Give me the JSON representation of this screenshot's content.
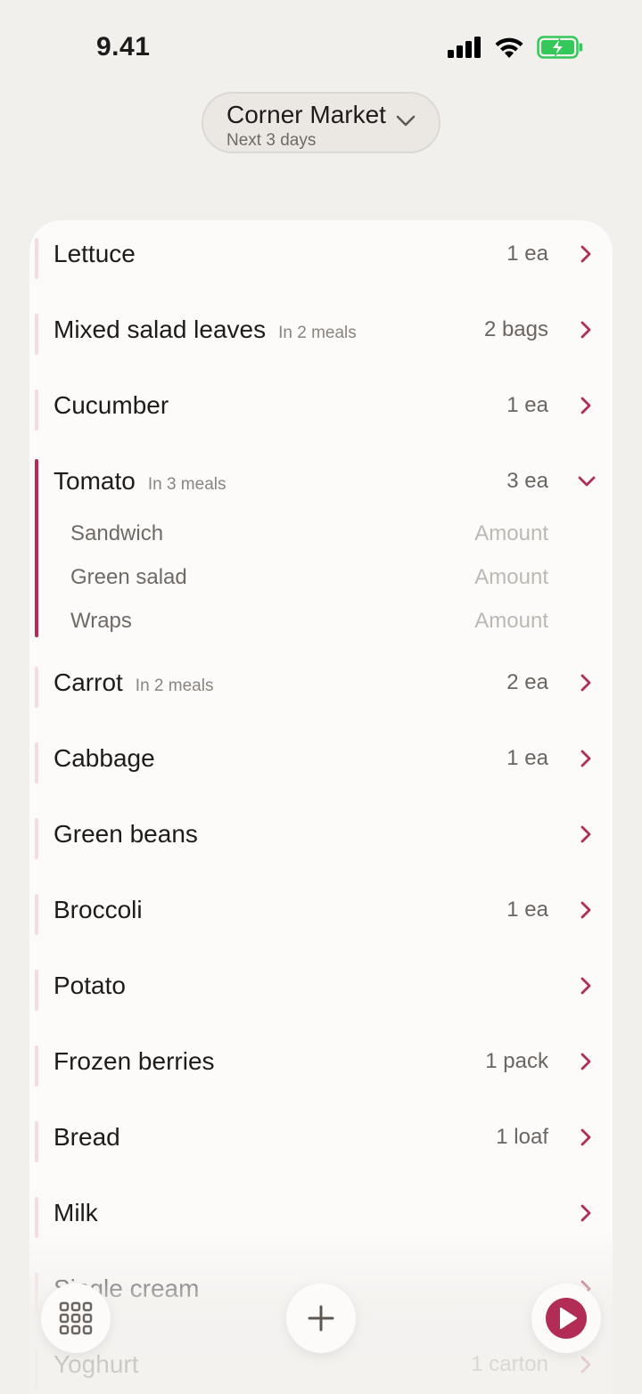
{
  "status_bar": {
    "time": "9.41"
  },
  "store": {
    "name": "Corner Market",
    "range": "Next 3 days"
  },
  "items": [
    {
      "name": "Lettuce",
      "meals": "",
      "qty": "1 ea"
    },
    {
      "name": "Mixed salad leaves",
      "meals": "In 2 meals",
      "qty": "2 bags"
    },
    {
      "name": "Cucumber",
      "meals": "",
      "qty": "1 ea"
    },
    {
      "name": "Tomato",
      "meals": "In 3 meals",
      "qty": "3 ea"
    },
    {
      "name": "Carrot",
      "meals": "In 2 meals",
      "qty": "2 ea"
    },
    {
      "name": "Cabbage",
      "meals": "",
      "qty": "1 ea"
    },
    {
      "name": "Green beans",
      "meals": "",
      "qty": ""
    },
    {
      "name": "Broccoli",
      "meals": "",
      "qty": "1 ea"
    },
    {
      "name": "Potato",
      "meals": "",
      "qty": ""
    },
    {
      "name": "Frozen berries",
      "meals": "",
      "qty": "1 pack"
    },
    {
      "name": "Bread",
      "meals": "",
      "qty": "1 loaf"
    },
    {
      "name": "Milk",
      "meals": "",
      "qty": ""
    },
    {
      "name": "Single cream",
      "meals": "",
      "qty": ""
    },
    {
      "name": "Yoghurt",
      "meals": "",
      "qty": "1 carton"
    }
  ],
  "expanded_item": {
    "meals": [
      {
        "name": "Sandwich",
        "amount_placeholder": "Amount"
      },
      {
        "name": "Green salad",
        "amount_placeholder": "Amount"
      },
      {
        "name": "Wraps",
        "amount_placeholder": "Amount"
      }
    ]
  },
  "colors": {
    "accent": "#b12d55",
    "accent_light": "#f3dce1",
    "background": "#f2f0ed",
    "card": "#fcfbf9",
    "battery_green": "#34c759"
  },
  "icons": {
    "cellular": "cellular-signal-icon",
    "wifi": "wifi-icon",
    "battery": "battery-charging-icon",
    "store_dropdown": "chevron-down-icon",
    "row_action": "chevron-right-icon",
    "row_expanded": "chevron-down-icon",
    "grid": "grid-icon",
    "add": "plus-icon",
    "play": "play-icon"
  }
}
